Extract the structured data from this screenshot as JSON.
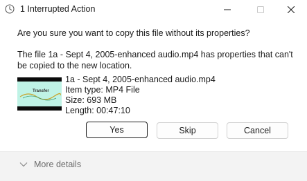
{
  "window": {
    "title": "1 Interrupted Action",
    "icons": {
      "app": "clock-icon",
      "minimize": "minimize-icon",
      "maximize": "maximize-icon",
      "close": "close-icon"
    }
  },
  "dialog": {
    "question": "Are you sure you want to copy this file without its properties?",
    "message": "The file 1a - Sept 4, 2005-enhanced audio.mp4 has properties that can't be copied to the new location.",
    "file": {
      "name": "1a - Sept 4, 2005-enhanced audio.mp4",
      "type": "Item type: MP4 File",
      "size": "Size: 693 MB",
      "length": "Length: 00:47:10"
    },
    "thumbnail_text": "Transfer"
  },
  "buttons": {
    "yes": "Yes",
    "skip": "Skip",
    "cancel": "Cancel"
  },
  "footer": {
    "more_details": "More details",
    "icon": "chevron-down-icon"
  },
  "colors": {
    "background": "#ffffff",
    "footer": "#f3f3f3",
    "thumbnail_bg": "#bff3e6"
  }
}
